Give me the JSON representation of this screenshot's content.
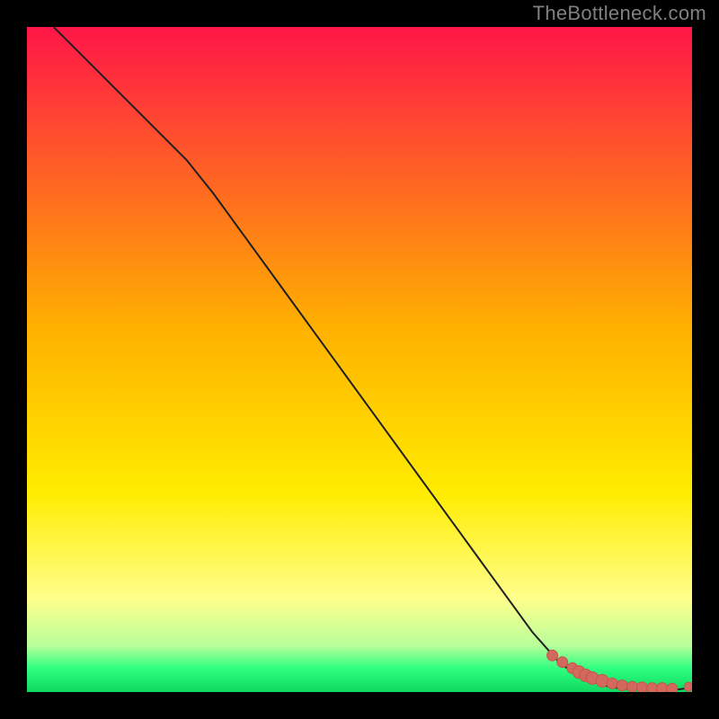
{
  "watermark": "TheBottleneck.com",
  "colors": {
    "top": "#ff1648",
    "mid": "#ffec00",
    "low_yellow": "#ffff8c",
    "green_band": "#2eff80",
    "green_edge": "#0fd860",
    "line": "#202020",
    "dot_fill": "#d3695e",
    "dot_stroke": "#c55449"
  },
  "chart_data": {
    "type": "line",
    "title": "",
    "xlabel": "",
    "ylabel": "",
    "xlim": [
      0,
      100
    ],
    "ylim": [
      0,
      100
    ],
    "series": [
      {
        "name": "curve",
        "x": [
          4,
          8,
          12,
          16,
          20,
          24,
          28,
          32,
          36,
          40,
          44,
          48,
          52,
          56,
          60,
          64,
          68,
          72,
          76,
          80,
          82,
          84,
          86,
          88,
          90,
          92,
          94,
          96,
          98,
          99.5
        ],
        "y": [
          100,
          96,
          92,
          88,
          84,
          80,
          75,
          69.5,
          64,
          58.5,
          53,
          47.5,
          42,
          36.5,
          31,
          25.5,
          20,
          14.5,
          9,
          4.5,
          3,
          2,
          1.2,
          0.7,
          0.5,
          0.4,
          0.4,
          0.4,
          0.4,
          0.6
        ]
      }
    ],
    "scatter": {
      "name": "cluster",
      "x": [
        79,
        80.5,
        82,
        83,
        84,
        85,
        86.5,
        88,
        89.5,
        91,
        92.5,
        94,
        95.5,
        97,
        99.5
      ],
      "y": [
        5.5,
        4.5,
        3.6,
        3.0,
        2.5,
        2.1,
        1.7,
        1.3,
        1.0,
        0.8,
        0.7,
        0.6,
        0.6,
        0.5,
        0.8
      ],
      "r": [
        6,
        6,
        6,
        7,
        7,
        7,
        7,
        6,
        6,
        6,
        6,
        6,
        6,
        6,
        5
      ]
    },
    "gradient_stops": [
      {
        "offset": 0.0,
        "color": "#ff1648"
      },
      {
        "offset": 0.45,
        "color": "#ffb000"
      },
      {
        "offset": 0.7,
        "color": "#ffec00"
      },
      {
        "offset": 0.86,
        "color": "#ffff8c"
      },
      {
        "offset": 0.93,
        "color": "#b8ff9a"
      },
      {
        "offset": 0.965,
        "color": "#2eff80"
      },
      {
        "offset": 1.0,
        "color": "#0fd860"
      }
    ]
  }
}
